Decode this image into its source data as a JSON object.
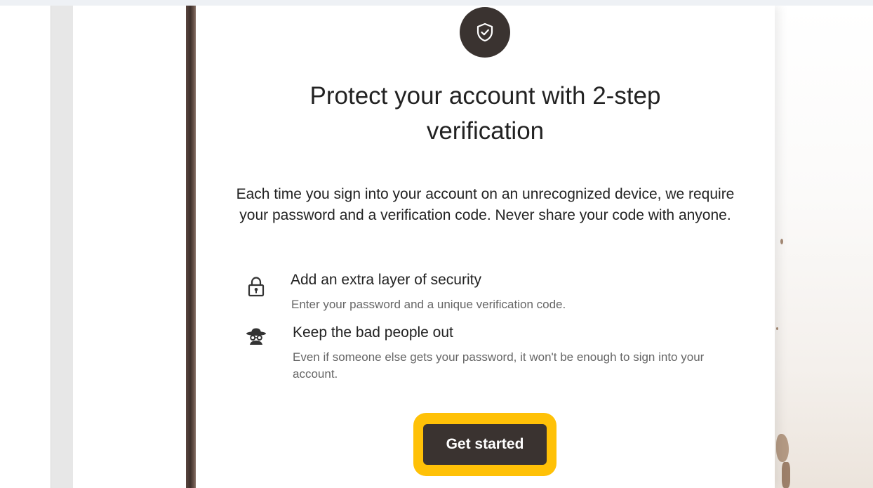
{
  "dialog": {
    "badge_icon": "shield-check-icon",
    "title": "Protect your account with 2-step verification",
    "description": "Each time you sign into your account on an unrecognized device, we require your password and a verification code. Never share your code with anyone.",
    "features": [
      {
        "icon": "lock-icon",
        "title": "Add an extra layer of security",
        "description": "Enter your password and a unique verification code."
      },
      {
        "icon": "spy-icon",
        "title": "Keep the bad people out",
        "description": "Even if someone else gets your password, it won't be enough to sign into your account."
      }
    ],
    "cta_label": "Get started"
  },
  "colors": {
    "button_bg": "#3a3330",
    "highlight": "#ffc107",
    "text": "#222222",
    "muted_text": "#666666"
  }
}
